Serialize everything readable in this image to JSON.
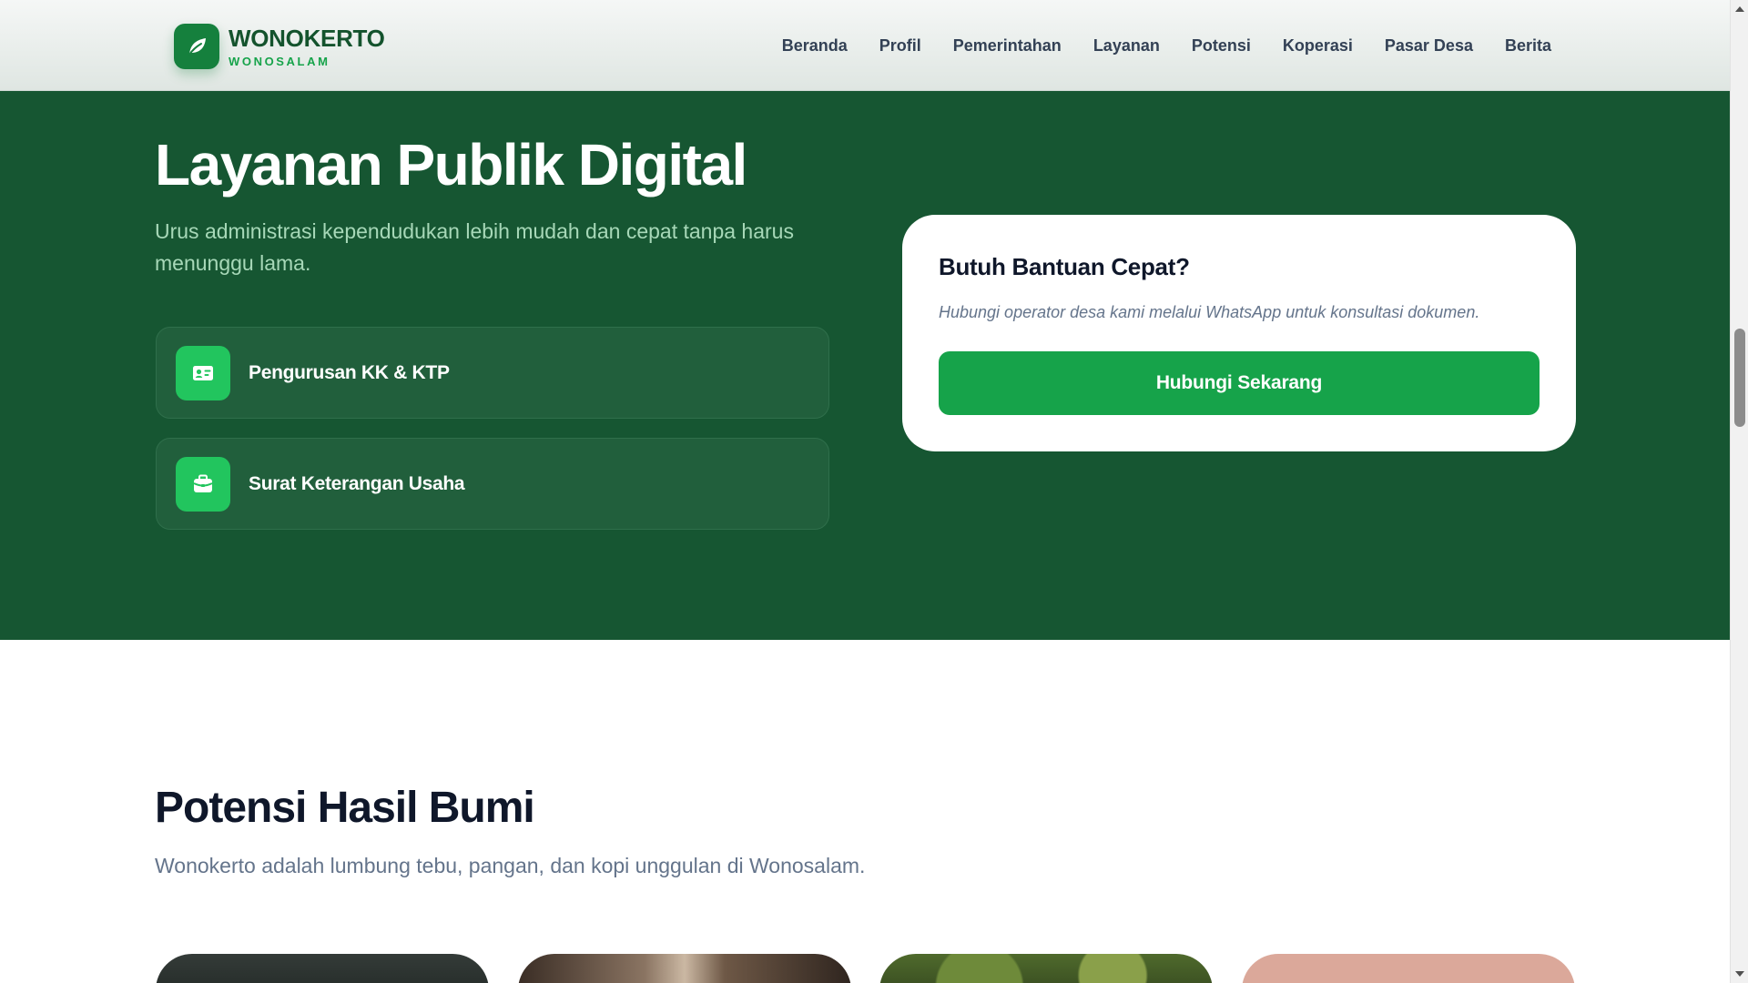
{
  "header": {
    "brand_name": "WONOKERTO",
    "brand_sub": "WONOSALAM",
    "logo_icon": "leaf-icon",
    "nav": [
      "Beranda",
      "Profil",
      "Pemerintahan",
      "Layanan",
      "Potensi",
      "Koperasi",
      "Pasar Desa",
      "Berita"
    ]
  },
  "hero": {
    "title": "Layanan Publik Digital",
    "subtitle": "Urus administrasi kependudukan lebih mudah dan cepat tanpa harus menunggu lama.",
    "services": [
      {
        "label": "Pengurusan KK & KTP",
        "icon": "id-card-icon"
      },
      {
        "label": "Surat Keterangan Usaha",
        "icon": "briefcase-icon"
      }
    ],
    "help": {
      "title": "Butuh Bantuan Cepat?",
      "description": "Hubungi operator desa kami melalui WhatsApp untuk konsultasi dokumen.",
      "button": "Hubungi Sekarang"
    }
  },
  "potensi": {
    "title": "Potensi Hasil Bumi",
    "subtitle": "Wonokerto adalah lumbung tebu, pangan, dan kopi unggulan di Wonosalam."
  },
  "colors": {
    "hero_bg": "#165632",
    "primary": "#16a34a",
    "accent_icon": "#22c55e",
    "brand_text": "#14532d"
  }
}
